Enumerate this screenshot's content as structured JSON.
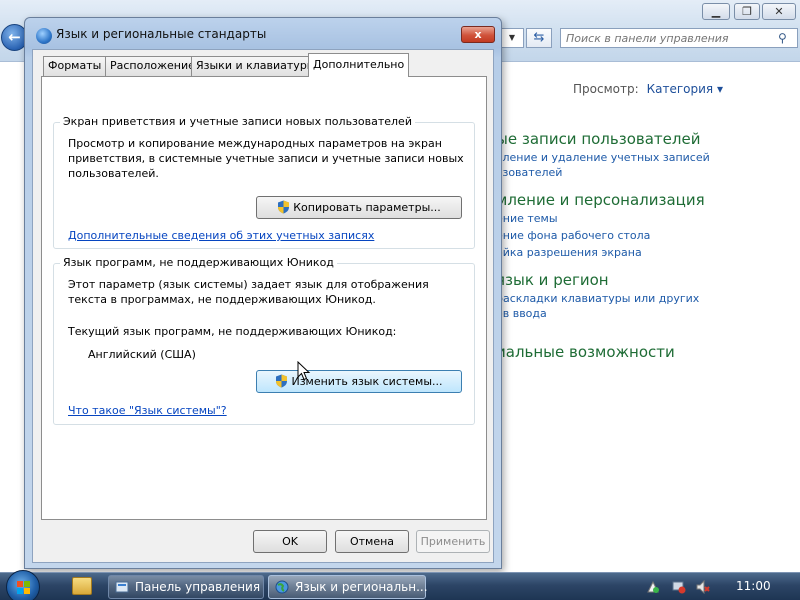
{
  "control_panel": {
    "search_placeholder": "Поиск в панели управления",
    "view_label": "Просмотр:",
    "view_value": "Категория",
    "categories": [
      {
        "title": "ые записи пользователей",
        "links": [
          "вление и удаление учетных записей",
          "ьзователей"
        ]
      },
      {
        "title": "мление и персонализация",
        "links": [
          "ение темы",
          "ение фона рабочего стола",
          "ойка разрешения экрана"
        ]
      },
      {
        "title": "язык и регион",
        "links": [
          "раскладки клавиатуры или других",
          "ов ввода"
        ]
      },
      {
        "title": "иальные возможности",
        "links": []
      }
    ]
  },
  "dialog": {
    "title": "Язык и региональные стандарты",
    "close_label": "x",
    "tabs": [
      {
        "label": "Форматы"
      },
      {
        "label": "Расположение"
      },
      {
        "label": "Языки и клавиатуры"
      },
      {
        "label": "Дополнительно"
      }
    ],
    "welcome_group": {
      "title": "Экран приветствия и учетные записи новых пользователей",
      "description": "Просмотр и копирование международных параметров на экран приветствия, в системные учетные записи и учетные записи новых пользователей.",
      "copy_button": "Копировать параметры...",
      "more_link": "Дополнительные сведения об этих учетных записях"
    },
    "unicode_group": {
      "title": "Язык программ, не поддерживающих Юникод",
      "description": "Этот параметр (язык системы) задает язык для отображения текста в программах, не поддерживающих Юникод.",
      "current_label": "Текущий язык программ, не поддерживающих Юникод:",
      "current_value": "Английский (США)",
      "change_button": "Изменить язык системы...",
      "what_link": "Что такое \"Язык системы\"?"
    },
    "ok_button": "OK",
    "cancel_button": "Отмена",
    "apply_button": "Применить"
  },
  "taskbar": {
    "items": [
      {
        "label": "Панель управления"
      },
      {
        "label": "Язык и региональн..."
      }
    ],
    "clock": "11:00"
  },
  "colors": {
    "link": "#0645c0",
    "category_title": "#1e6c35",
    "category_link": "#1e5aa8"
  }
}
